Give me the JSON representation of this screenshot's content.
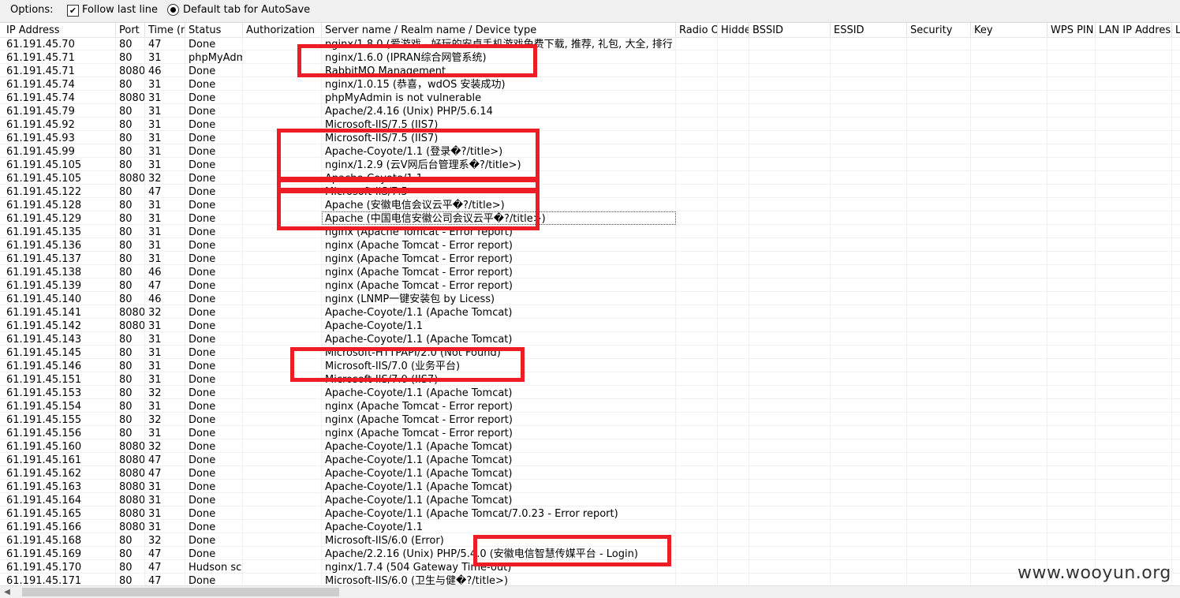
{
  "options": {
    "label": "Options:",
    "follow_last_line": "Follow last line",
    "default_tab": "Default tab for AutoSave",
    "follow_checked": true,
    "default_tab_selected": true
  },
  "columns": [
    "IP Address",
    "Port",
    "Time (m",
    "Status",
    "Authorization",
    "Server name / Realm name / Device type",
    "Radio Of",
    "Hidden",
    "BSSID",
    "ESSID",
    "Security",
    "Key",
    "WPS PIN",
    "LAN IP Address",
    "L"
  ],
  "rows": [
    [
      "61.191.45.70",
      "80",
      "47",
      "Done",
      "",
      "nginx/1.8.0 (爱游戏 - 好玩的安卓手机游戏免费下载, 推荐, 礼包, 大全, 排行"
    ],
    [
      "61.191.45.71",
      "80",
      "31",
      "phpMyAdm",
      "",
      "nginx/1.6.0 (IPRAN综合网管系统)"
    ],
    [
      "61.191.45.71",
      "8080",
      "46",
      "Done",
      "",
      "RabbitMQ Management"
    ],
    [
      "61.191.45.74",
      "80",
      "31",
      "Done",
      "",
      "nginx/1.0.15 (恭喜，wdOS 安装成功)"
    ],
    [
      "61.191.45.74",
      "8080",
      "31",
      "Done",
      "",
      "phpMyAdmin is not vulnerable"
    ],
    [
      "61.191.45.79",
      "80",
      "31",
      "Done",
      "",
      "Apache/2.4.16 (Unix) PHP/5.6.14"
    ],
    [
      "61.191.45.92",
      "80",
      "31",
      "Done",
      "",
      "Microsoft-IIS/7.5 (IIS7)"
    ],
    [
      "61.191.45.93",
      "80",
      "31",
      "Done",
      "",
      "Microsoft-IIS/7.5 (IIS7)"
    ],
    [
      "61.191.45.99",
      "80",
      "31",
      "Done",
      "",
      "Apache-Coyote/1.1 (登录�?/title>)"
    ],
    [
      "61.191.45.105",
      "80",
      "31",
      "Done",
      "",
      "nginx/1.2.9 (云V网后台管理系�?/title>)"
    ],
    [
      "61.191.45.105",
      "8080",
      "32",
      "Done",
      "",
      "Apache-Coyote/1.1"
    ],
    [
      "61.191.45.122",
      "80",
      "47",
      "Done",
      "",
      "Microsoft-IIS/7.5"
    ],
    [
      "61.191.45.128",
      "80",
      "31",
      "Done",
      "",
      "Apache (安徽电信会议云平�?/title>)"
    ],
    [
      "61.191.45.129",
      "80",
      "31",
      "Done",
      "",
      "Apache (中国电信安徽公司会议云平�?/title>)"
    ],
    [
      "61.191.45.135",
      "80",
      "31",
      "Done",
      "",
      "nginx (Apache Tomcat - Error report)"
    ],
    [
      "61.191.45.136",
      "80",
      "31",
      "Done",
      "",
      "nginx (Apache Tomcat - Error report)"
    ],
    [
      "61.191.45.137",
      "80",
      "31",
      "Done",
      "",
      "nginx (Apache Tomcat - Error report)"
    ],
    [
      "61.191.45.138",
      "80",
      "46",
      "Done",
      "",
      "nginx (Apache Tomcat - Error report)"
    ],
    [
      "61.191.45.139",
      "80",
      "47",
      "Done",
      "",
      "nginx (Apache Tomcat - Error report)"
    ],
    [
      "61.191.45.140",
      "80",
      "46",
      "Done",
      "",
      "nginx (LNMP一键安装包 by Licess)"
    ],
    [
      "61.191.45.141",
      "8080",
      "32",
      "Done",
      "",
      "Apache-Coyote/1.1 (Apache Tomcat)"
    ],
    [
      "61.191.45.142",
      "8080",
      "31",
      "Done",
      "",
      "Apache-Coyote/1.1"
    ],
    [
      "61.191.45.143",
      "80",
      "31",
      "Done",
      "",
      "Apache-Coyote/1.1 (Apache Tomcat)"
    ],
    [
      "61.191.45.145",
      "80",
      "31",
      "Done",
      "",
      "Microsoft-HTTPAPI/2.0 (Not Found)"
    ],
    [
      "61.191.45.146",
      "80",
      "31",
      "Done",
      "",
      "Microsoft-IIS/7.0 (业务平台)"
    ],
    [
      "61.191.45.151",
      "80",
      "31",
      "Done",
      "",
      "Microsoft-IIS/7.0 (IIS7)"
    ],
    [
      "61.191.45.153",
      "80",
      "32",
      "Done",
      "",
      "Apache-Coyote/1.1 (Apache Tomcat)"
    ],
    [
      "61.191.45.154",
      "80",
      "31",
      "Done",
      "",
      "nginx (Apache Tomcat - Error report)"
    ],
    [
      "61.191.45.155",
      "80",
      "32",
      "Done",
      "",
      "nginx (Apache Tomcat - Error report)"
    ],
    [
      "61.191.45.156",
      "80",
      "31",
      "Done",
      "",
      "nginx (Apache Tomcat - Error report)"
    ],
    [
      "61.191.45.160",
      "8080",
      "32",
      "Done",
      "",
      "Apache-Coyote/1.1 (Apache Tomcat)"
    ],
    [
      "61.191.45.161",
      "8080",
      "47",
      "Done",
      "",
      "Apache-Coyote/1.1 (Apache Tomcat)"
    ],
    [
      "61.191.45.162",
      "8080",
      "47",
      "Done",
      "",
      "Apache-Coyote/1.1 (Apache Tomcat)"
    ],
    [
      "61.191.45.163",
      "8080",
      "31",
      "Done",
      "",
      "Apache-Coyote/1.1 (Apache Tomcat)"
    ],
    [
      "61.191.45.164",
      "8080",
      "31",
      "Done",
      "",
      "Apache-Coyote/1.1 (Apache Tomcat)"
    ],
    [
      "61.191.45.165",
      "8080",
      "31",
      "Done",
      "",
      "Apache-Coyote/1.1 (Apache Tomcat/7.0.23 - Error report)"
    ],
    [
      "61.191.45.166",
      "8080",
      "31",
      "Done",
      "",
      "Apache-Coyote/1.1"
    ],
    [
      "61.191.45.168",
      "80",
      "32",
      "Done",
      "",
      "Microsoft-IIS/6.0 (Error)"
    ],
    [
      "61.191.45.169",
      "80",
      "47",
      "Done",
      "",
      "Apache/2.2.16 (Unix) PHP/5.4.0 (安徽电信智慧传媒平台 - Login)"
    ],
    [
      "61.191.45.170",
      "80",
      "47",
      "Hudson sca",
      "",
      "nginx/1.7.4 (504 Gateway Time-out)"
    ],
    [
      "61.191.45.171",
      "80",
      "47",
      "Done",
      "",
      "Microsoft-IIS/6.0 (卫生与健�?/title>)"
    ]
  ],
  "highlight_color": "#ee1c25",
  "watermark": "www.wooyun.org",
  "scrollbar": {
    "left_arrow": "◀"
  }
}
